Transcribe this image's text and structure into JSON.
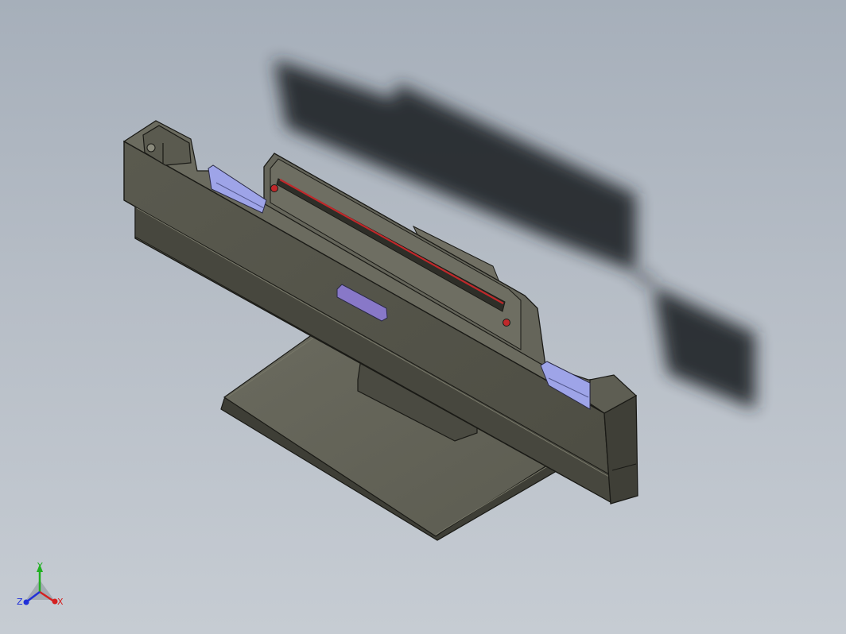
{
  "viewport": {
    "background_top": "#a6afba",
    "background_bottom": "#c6ccd3",
    "model_color": "#5f5e53",
    "model_edge_color": "#1a1a16",
    "accent_red": "#c0282a",
    "accent_purple": "#8878c8",
    "accent_lavender": "#9ea4e8"
  },
  "triad": {
    "x_label": "X",
    "y_label": "Y",
    "z_label": "Z",
    "x_color": "#d42020",
    "y_color": "#20b020",
    "z_color": "#2030d8"
  }
}
